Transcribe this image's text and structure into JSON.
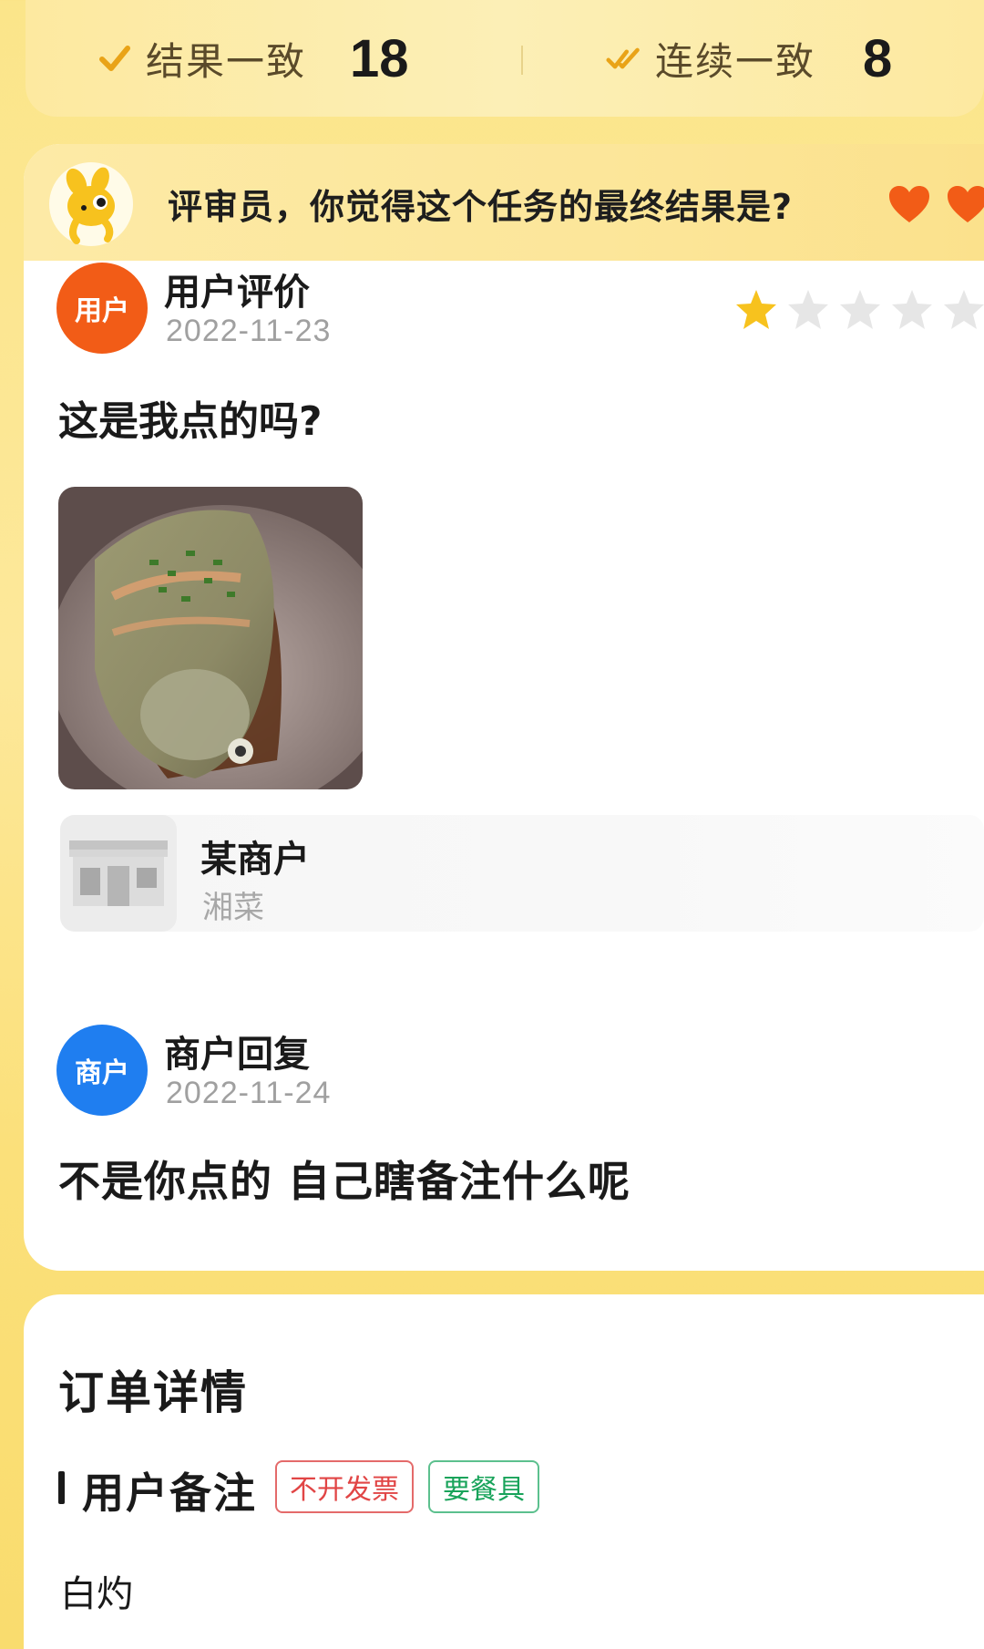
{
  "stats": {
    "consistent_label": "结果一致",
    "consistent_value": "18",
    "streak_label": "连续一致",
    "streak_value": "8",
    "consistent_icon": "check-icon",
    "streak_icon": "double-check-icon"
  },
  "question": {
    "text": "评审员，你觉得这个任务的最终结果是?",
    "lives": 2,
    "heart_color": "#f25c17"
  },
  "user_review": {
    "avatar_label": "用户",
    "title": "用户评价",
    "date": "2022-11-23",
    "rating": 1,
    "rating_max": 5,
    "text": "这是我点的吗?",
    "photo": "fish-dish-photo"
  },
  "shop": {
    "name": "某商户",
    "category": "湘菜",
    "icon": "storefront-icon"
  },
  "merchant_reply": {
    "avatar_label": "商户",
    "title": "商户回复",
    "date": "2022-11-24",
    "text": "不是你点的 自己瞎备注什么呢"
  },
  "order": {
    "title": "订单详情",
    "note_section_title": "用户备注",
    "tags": [
      "不开发票",
      "要餐具"
    ],
    "note": "白灼"
  },
  "colors": {
    "user_avatar": "#f25c17",
    "merchant_avatar": "#1f7ef0",
    "star_active": "#f7c21e",
    "star_inactive": "#e6e6e6",
    "check": "#e9a317"
  }
}
